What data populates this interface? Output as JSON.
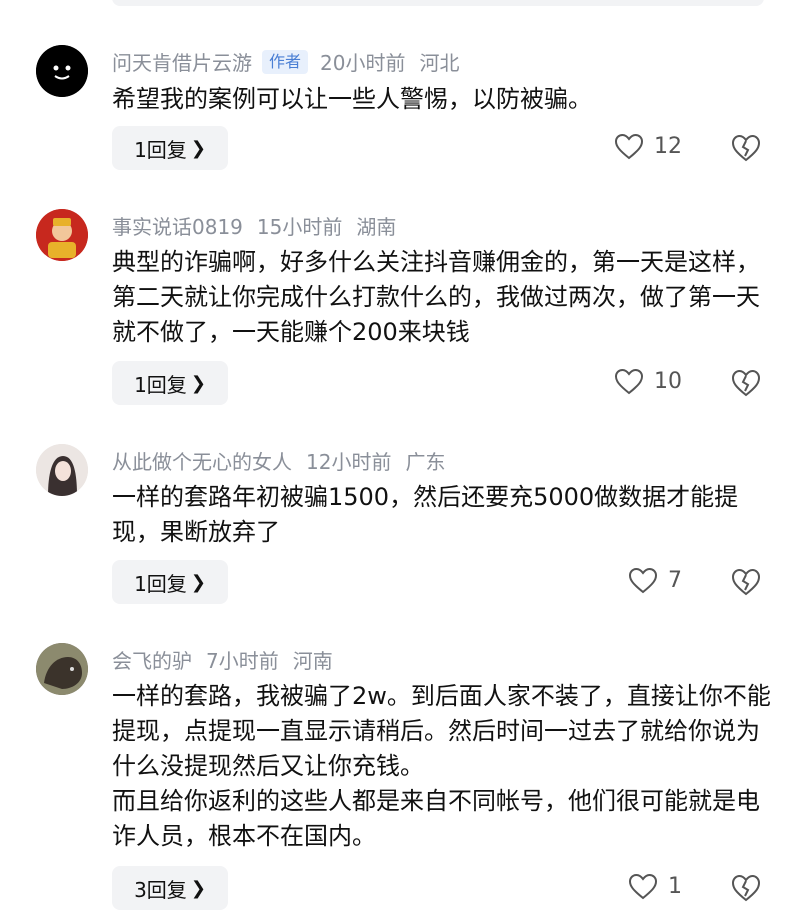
{
  "comments": [
    {
      "username": "问天肯借片云游",
      "author_tag": "作者",
      "time": "20小时前",
      "location": "河北",
      "text": "希望我的案例可以让一些人警惕，以防被骗。",
      "reply_label": "1回复",
      "likes": "12"
    },
    {
      "username": "事实说话0819",
      "time": "15小时前",
      "location": "湖南",
      "text": "典型的诈骗啊，好多什么关注抖音赚佣金的，第一天是这样，第二天就让你完成什么打款什么的，我做过两次，做了第一天就不做了，一天能赚个200来块钱",
      "reply_label": "1回复",
      "likes": "10"
    },
    {
      "username": "从此做个无心的女人",
      "time": "12小时前",
      "location": "广东",
      "text": "一样的套路年初被骗1500，然后还要充5000做数据才能提现，果断放弃了",
      "reply_label": "1回复",
      "likes": "7"
    },
    {
      "username": "会飞的驴",
      "time": "7小时前",
      "location": "河南",
      "text": "一样的套路，我被骗了2w。到后面人家不装了，直接让你不能提现，点提现一直显示请稍后。然后时间一过去了就给你说为什么没提现然后又让你充钱。\n而且给你返利的这些人都是来自不同帐号，他们很可能就是电诈人员，根本不在国内。",
      "reply_label": "3回复",
      "likes": "1"
    }
  ],
  "icons": {
    "like": "heart-outline-icon",
    "dislike": "broken-heart-icon",
    "reply_chevron": "chevron-right-icon"
  },
  "colors": {
    "meta_gray": "#8a8f99",
    "author_tag_blue": "#4a7fd4",
    "reply_bg": "#f2f3f5"
  }
}
